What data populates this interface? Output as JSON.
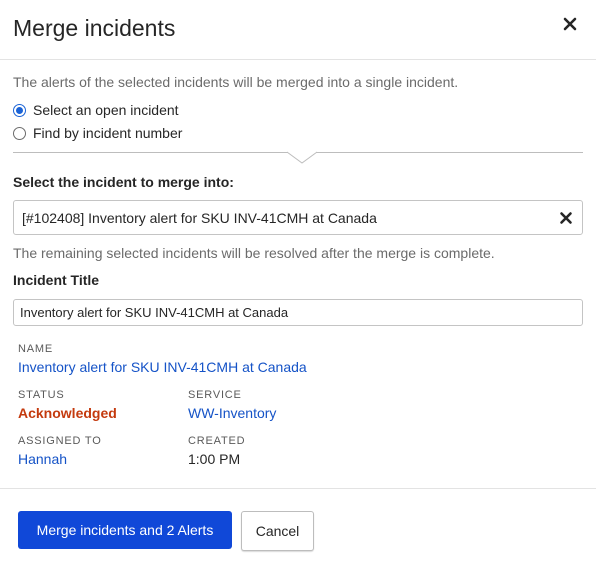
{
  "modal": {
    "title": "Merge incidents",
    "description": "The alerts of the selected incidents will be merged into a single incident."
  },
  "options": [
    {
      "label": "Select an open incident",
      "selected": true
    },
    {
      "label": "Find by incident number",
      "selected": false
    }
  ],
  "merge_into": {
    "label": "Select the incident to merge into:",
    "selected_value": "[#102408] Inventory alert for SKU INV-41CMH at Canada",
    "note": "The remaining selected incidents will be resolved after the merge is complete."
  },
  "incident_title": {
    "label": "Incident Title",
    "value": "Inventory alert for SKU INV-41CMH at Canada"
  },
  "details": {
    "name_label": "NAME",
    "name_value": "Inventory alert for SKU INV-41CMH at Canada",
    "status_label": "STATUS",
    "status_value": "Acknowledged",
    "service_label": "SERVICE",
    "service_value": "WW-Inventory",
    "assigned_label": "ASSIGNED TO",
    "assigned_value": "Hannah",
    "created_label": "CREATED",
    "created_value": "1:00 PM"
  },
  "footer": {
    "merge_label": "Merge incidents and 2 Alerts",
    "cancel_label": "Cancel"
  },
  "icons": {
    "close": "close-icon",
    "clear": "clear-selection-icon"
  },
  "colors": {
    "primary": "#1048d8",
    "link": "#1553c7",
    "acknowledged": "#c43a0e",
    "radio_selected": "#1b63d6"
  }
}
